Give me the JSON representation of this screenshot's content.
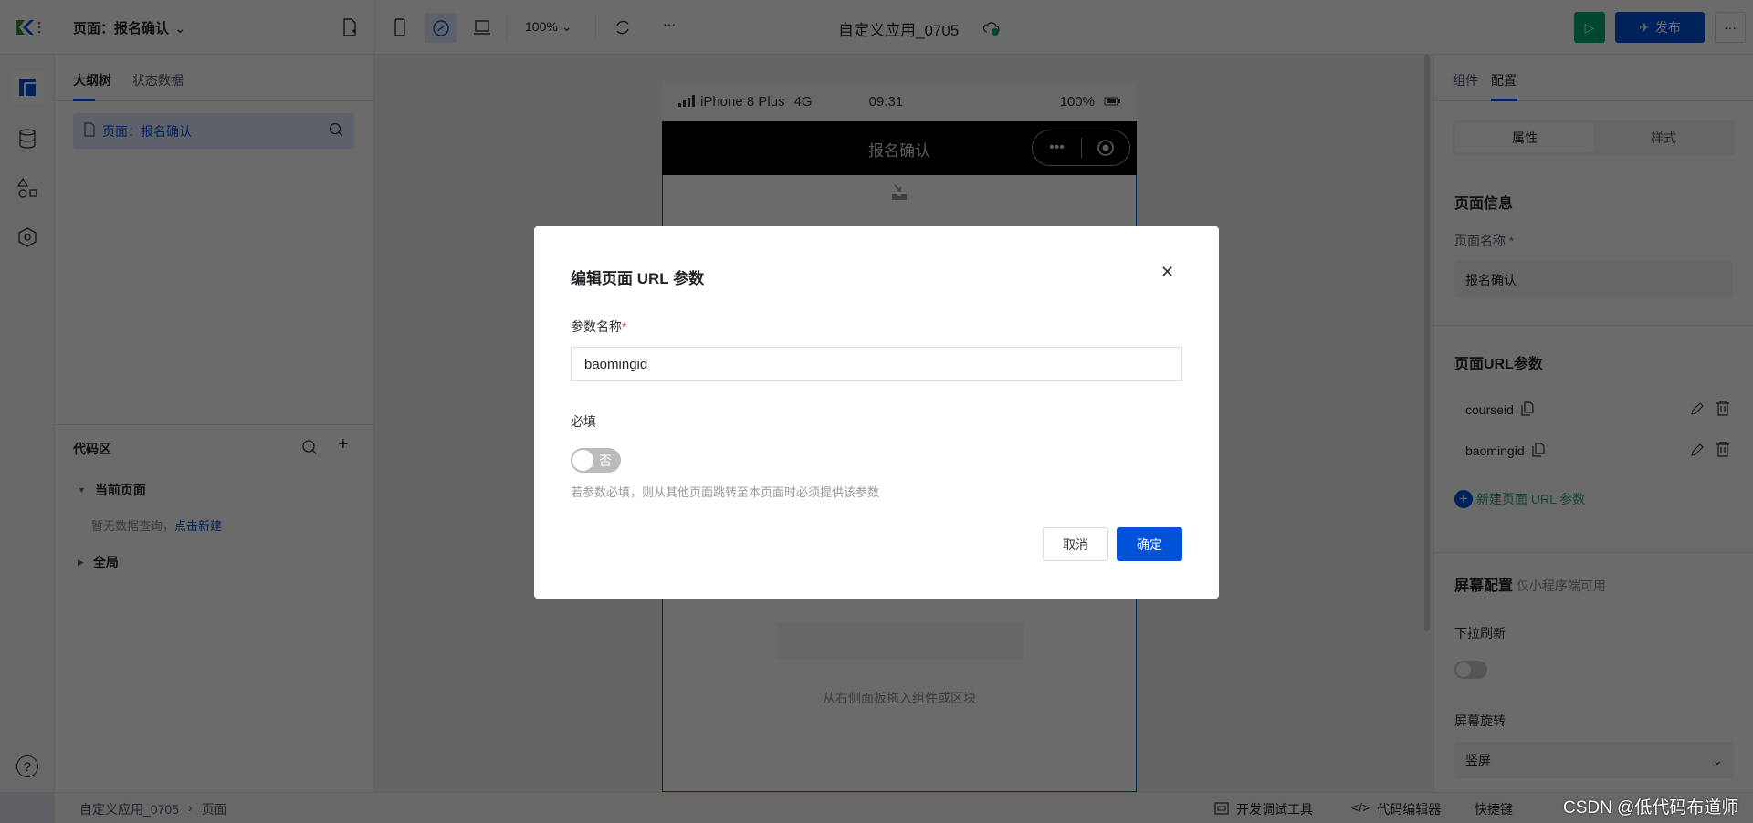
{
  "topbar": {
    "page_selector": "页面：报名确认",
    "zoom": "100%",
    "app_title": "自定义应用_0705",
    "publish": "发布",
    "more": "···"
  },
  "left": {
    "tabs": [
      "大纲树",
      "状态数据"
    ],
    "page_item": "页面：报名确认",
    "code_area": {
      "title": "代码区",
      "current_page": "当前页面",
      "empty_text": "暂无数据查询，",
      "create_link": "点击新建",
      "global": "全局"
    }
  },
  "canvas": {
    "status": {
      "carrier": "iPhone 8 Plus",
      "network": "4G",
      "time": "09:31",
      "battery": "100%"
    },
    "nav_title": "报名确认",
    "drop_hint": "从右侧面板拖入组件或区块"
  },
  "right": {
    "tabs": [
      "组件",
      "配置"
    ],
    "segments": [
      "属性",
      "样式"
    ],
    "page_info": "页面信息",
    "page_name_label": "页面名称",
    "page_name_value": "报名确认",
    "url_params_title": "页面URL参数",
    "params": [
      "courseid",
      "baomingid"
    ],
    "add_param": "新建页面 URL 参数",
    "screen_config": "屏幕配置",
    "screen_config_note": "仅小程序端可用",
    "pull_refresh": "下拉刷新",
    "rotation": "屏幕旋转",
    "rotation_value": "竖屏"
  },
  "bottom": {
    "breadcrumb": [
      "自定义应用_0705",
      "页面"
    ],
    "tools": [
      "开发调试工具",
      "代码编辑器",
      "快捷键"
    ],
    "watermark": "CSDN @低代码布道师"
  },
  "dialog": {
    "title": "编辑页面 URL 参数",
    "name_label": "参数名称",
    "name_value": "baomingid",
    "required_label": "必填",
    "toggle_text": "否",
    "hint": "若参数必填，则从其他页面跳转至本页面时必须提供该参数",
    "cancel": "取消",
    "confirm": "确定"
  },
  "colors": {
    "primary": "#0052d9",
    "run": "#00a870",
    "required": "#e34d59",
    "add_green": "#2ba471"
  }
}
